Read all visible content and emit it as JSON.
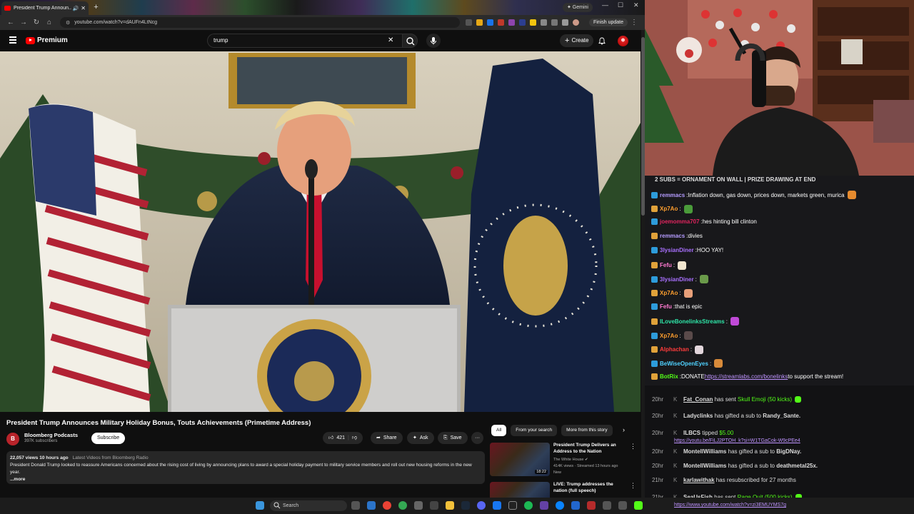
{
  "browser": {
    "tab_title": "President Trump Announ...",
    "new_tab": "+",
    "gemini_label": "✦ Gemini",
    "url": "youtube.com/watch?v=dAUFn4LtNcg",
    "finish_update": "Finish update"
  },
  "youtube": {
    "logo_text": "Premium",
    "search_value": "trump",
    "create_label": "Create",
    "video": {
      "title": "President Trump Announces Military Holiday Bonus, Touts Achievements (Primetime Address)",
      "channel": "Bloomberg Podcasts",
      "channel_initial": "B",
      "subscribers": "397K subscribers",
      "subscribe_label": "Subscribe",
      "likes": "421",
      "share_label": "Share",
      "ask_label": "Ask",
      "save_label": "Save",
      "more_label": "···",
      "views_time": "22,057 views  10 hours ago",
      "latest_link": "Latest Videos from Bloomberg Radio",
      "description": "President Donald Trump looked to reassure Americans concerned about the rising cost of living by announcing plans to award a special holiday payment to military service members and roll out new housing reforms in the new year.",
      "more": "...more"
    },
    "chips": [
      "All",
      "From your search",
      "More from this story"
    ],
    "recommendations": [
      {
        "title": "President Trump Delivers an Address to the Nation",
        "channel": "The White House",
        "stats": "414K views · Streamed 13 hours ago",
        "badge": "New",
        "duration": "18:22"
      },
      {
        "title": "LIVE: Trump addresses the nation (full speech)",
        "channel": "",
        "stats": "",
        "badge": "",
        "duration": ""
      }
    ]
  },
  "stream": {
    "banner": "2 SUBS = ORNAMENT ON WALL | PRIZE DRAWING AT END",
    "chat": [
      {
        "user": "remmacs",
        "text": "Inflation down, gas down, prices down, markets green, murica",
        "color": "#b59cff",
        "emote": "#e58a2e"
      },
      {
        "user": "Xp7Ao",
        "text": "",
        "color": "#ff9f2e",
        "emote": "#4a9b3a"
      },
      {
        "user": "joemomma707",
        "text": "hes hinting bill clinton",
        "color": "#e0245e",
        "emote": ""
      },
      {
        "user": "remmacs",
        "text": "divies",
        "color": "#b59cff",
        "emote": ""
      },
      {
        "user": "3lysianDiner",
        "text": "HOO YAY!",
        "color": "#a970ff",
        "emote": ""
      },
      {
        "user": "Fefu",
        "text": "",
        "color": "#ff7ad1",
        "emote": "#f1e6d0"
      },
      {
        "user": "3lysianDiner",
        "text": "",
        "color": "#a970ff",
        "emote": "#6a9a4a"
      },
      {
        "user": "Xp7Ao",
        "text": "",
        "color": "#ff9f2e",
        "emote": "#e8a07a"
      },
      {
        "user": "Fefu",
        "text": "that is epic",
        "color": "#ff7ad1",
        "emote": ""
      },
      {
        "user": "ILoveBonelinksStreams",
        "text": "",
        "color": "#2ee6a8",
        "emote": "#c04ad8"
      },
      {
        "user": "Xp7Ao",
        "text": "",
        "color": "#ff9f2e",
        "emote": "#5a4a4a"
      },
      {
        "user": "Alphachan",
        "text": "",
        "color": "#ff3b3b",
        "emote": "#e2d6dc"
      },
      {
        "user": "BeWiseOpenEyes",
        "text": "",
        "color": "#4fd1ff",
        "emote": "#d88a3a"
      },
      {
        "user": "BotRix",
        "text": "DONATE ",
        "link": "https://streamlabs.com/bonelinks",
        "suffix": " to support the stream!",
        "color": "#53fc18",
        "emote": ""
      }
    ],
    "events": [
      {
        "time": "20hr",
        "name": "Fat_Conan",
        "action": " has sent ",
        "highlight": "Skull Emoji (50 kicks)",
        "tail": "",
        "sub": ""
      },
      {
        "time": "20hr",
        "name": "Ladyclinks",
        "action": " has gifted a sub to ",
        "highlight": "",
        "tail": "Randy_Sante.",
        "sub": ""
      },
      {
        "time": "20hr",
        "name": "ILBCS",
        "action": " tipped ",
        "highlight": "$5.00",
        "tail": "",
        "sub": "https://youtu.be/FiLJ2PTOH_k?si=W1TGaCok-W9cPEe4"
      },
      {
        "time": "20hr",
        "name": "MontellWilliams",
        "action": " has gifted a sub to ",
        "highlight": "",
        "tail": "BigDNay.",
        "sub": ""
      },
      {
        "time": "20hr",
        "name": "MontellWilliams",
        "action": " has gifted a sub to ",
        "highlight": "",
        "tail": "deathmetal25x.",
        "sub": ""
      },
      {
        "time": "21hr",
        "name": "karlawithak",
        "action": " has resubscribed for 27 months",
        "highlight": "",
        "tail": "",
        "sub": ""
      },
      {
        "time": "21hr",
        "name": "SeaUsFish",
        "action": " has sent ",
        "highlight": "Rage Quit (500 kicks)",
        "tail": "",
        "sub": "https://www.youtube.com/watch?v=zi3EMUYMS7g"
      }
    ]
  },
  "taskbar": {
    "search_label": "Search"
  }
}
